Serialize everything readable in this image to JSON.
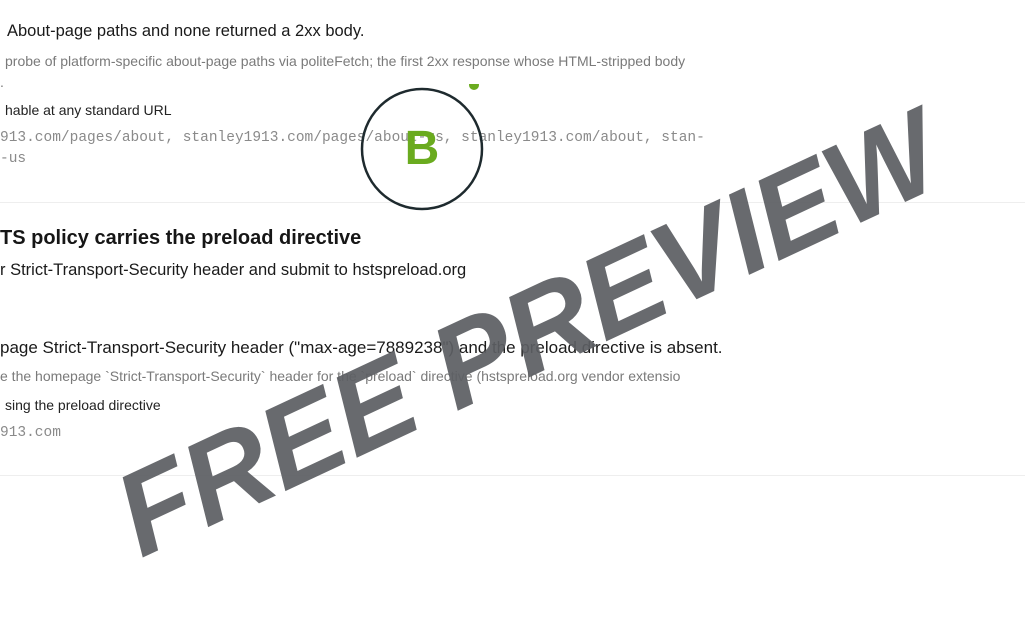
{
  "finding_about": {
    "observation": "About-page paths and none returned a 2xx body.",
    "method": "probe of platform-specific about-page paths via politeFetch; the first 2xx response whose HTML-stripped body",
    "method_tail": ".",
    "evidence_label": "hable at any standard URL",
    "paths_line1": "913.com/pages/about, stanley1913.com/pages/about-us, stanley1913.com/about, stan-",
    "paths_line2": "-us"
  },
  "finding_hsts": {
    "title": "TS policy carries the preload directive",
    "recommendation": "r Strict-Transport-Security header and submit to hstspreload.org",
    "observation": "page Strict-Transport-Security header (\"max-age=7889238\") and the preload directive is absent.",
    "method": "e the homepage `Strict-Transport-Security` header for the `preload` directive (hstspreload.org vendor extensio",
    "evidence_label": "sing the preload directive",
    "target": "913.com"
  },
  "grade_badge": {
    "letter": "B",
    "color": "#6aab1f",
    "ring_color": "#1e2a2e",
    "icon": "grade-ring-icon"
  },
  "watermark": {
    "text": "FREE PREVIEW",
    "color": "#5d5f63"
  }
}
